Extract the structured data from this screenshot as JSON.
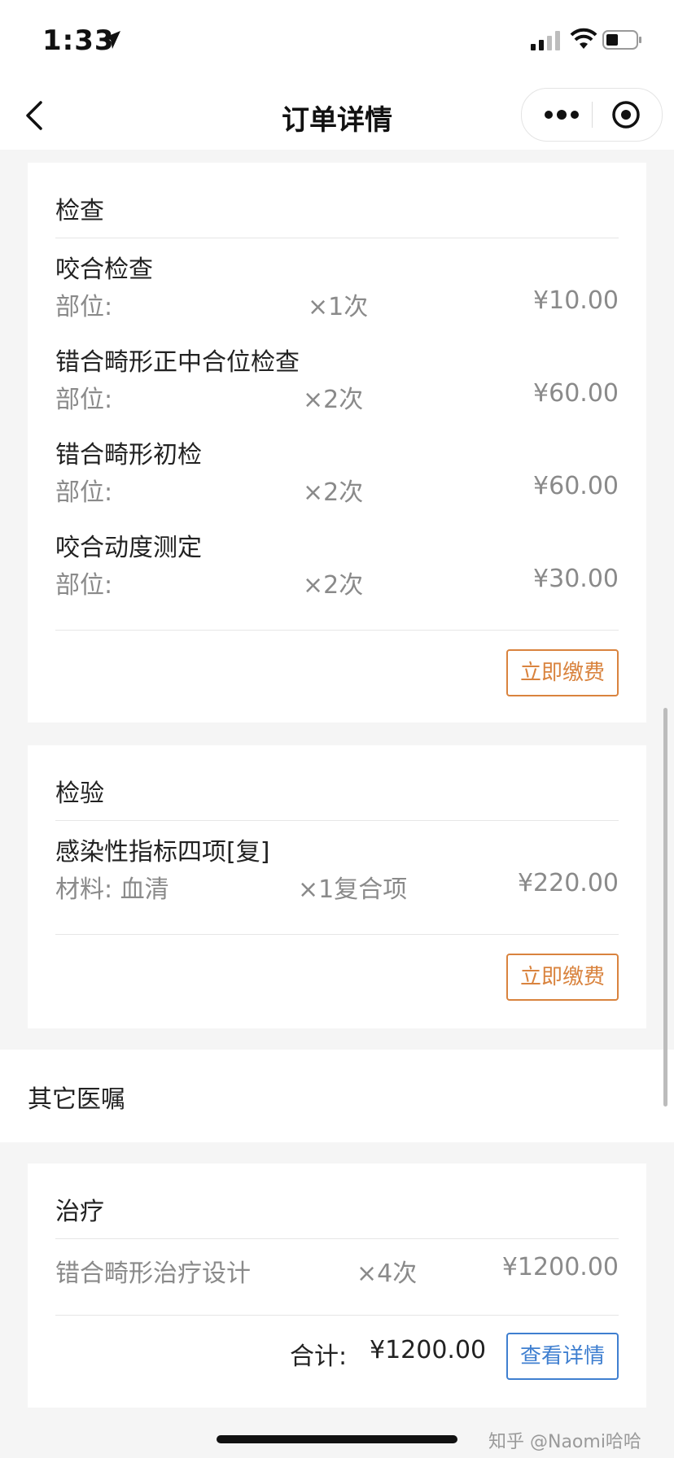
{
  "status_bar": {
    "time": "1:33"
  },
  "nav": {
    "title": "订单详情"
  },
  "exam": {
    "title": "检查",
    "items": [
      {
        "name": "咬合检查",
        "detail_label": "部位:",
        "qty": "×1次",
        "price": "¥10.00"
      },
      {
        "name": "错合畸形正中合位检查",
        "detail_label": "部位:",
        "qty": "×2次",
        "price": "¥60.00"
      },
      {
        "name": "错合畸形初检",
        "detail_label": "部位:",
        "qty": "×2次",
        "price": "¥60.00"
      },
      {
        "name": "咬合动度测定",
        "detail_label": "部位:",
        "qty": "×2次",
        "price": "¥30.00"
      }
    ],
    "pay_label": "立即缴费"
  },
  "lab": {
    "title": "检验",
    "items": [
      {
        "name": "感染性指标四项[复]",
        "detail_label": "材料: 血清",
        "qty": "×1复合项",
        "price": "¥220.00"
      }
    ],
    "pay_label": "立即缴费"
  },
  "other_orders": {
    "title": "其它医嘱"
  },
  "treatment": {
    "title": "治疗",
    "items": [
      {
        "name": "错合畸形治疗设计",
        "qty": "×4次",
        "price": "¥1200.00"
      }
    ],
    "total_label": "合计:",
    "total_value": "¥1200.00",
    "detail_button": "查看详情"
  },
  "watermark": "知乎 @Naomi哈哈",
  "colors": {
    "pay_button": "#d9833e",
    "detail_button": "#3f7fd0"
  }
}
